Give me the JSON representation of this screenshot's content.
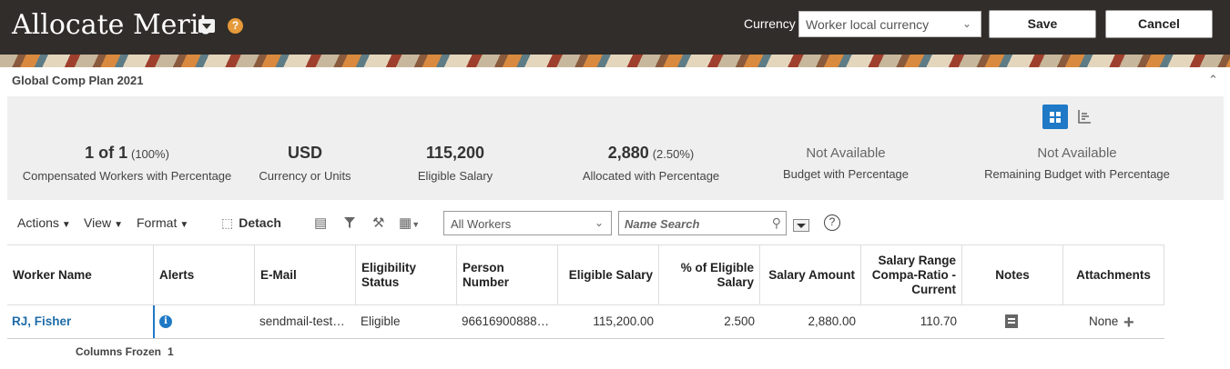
{
  "header": {
    "title": "Allocate Merit",
    "currency_label": "Currency",
    "currency_value": "Worker local currency",
    "save_label": "Save",
    "cancel_label": "Cancel"
  },
  "plan": {
    "title": "Global Comp Plan 2021"
  },
  "summary": {
    "workers": {
      "value": "1 of 1",
      "pct": "(100%)",
      "label": "Compensated Workers with Percentage"
    },
    "currency": {
      "value": "USD",
      "label": "Currency or Units"
    },
    "salary": {
      "value": "115,200",
      "label": "Eligible Salary"
    },
    "allocated": {
      "value": "2,880",
      "pct": "(2.50%)",
      "label": "Allocated with Percentage"
    },
    "budget": {
      "value": "Not Available",
      "label": "Budget with Percentage"
    },
    "remaining": {
      "value": "Not Available",
      "label": "Remaining Budget with Percentage"
    }
  },
  "toolbar": {
    "actions": "Actions",
    "view": "View",
    "format": "Format",
    "detach": "Detach",
    "filter_value": "All Workers",
    "search_placeholder": "Name Search"
  },
  "table": {
    "headers": {
      "worker_name": "Worker Name",
      "alerts": "Alerts",
      "email": "E-Mail",
      "eligibility": "Eligibility Status",
      "person_number": "Person Number",
      "eligible_salary": "Eligible Salary",
      "pct_eligible": "% of Eligible Salary",
      "salary_amount": "Salary Amount",
      "compa_ratio": "Salary Range Compa-Ratio - Current",
      "notes": "Notes",
      "attachments": "Attachments"
    },
    "rows": [
      {
        "worker_name": "RJ, Fisher",
        "email": "sendmail-test…",
        "eligibility": "Eligible",
        "person_number": "96616900888…",
        "eligible_salary": "115,200.00",
        "pct_eligible": "2.500",
        "salary_amount": "2,880.00",
        "compa_ratio": "110.70",
        "attachments": "None"
      }
    ]
  },
  "footer": {
    "columns_frozen_label": "Columns Frozen",
    "columns_frozen_value": "1"
  },
  "colors": {
    "header_bg": "#312d2a",
    "accent": "#1f79c6",
    "summary_bg": "#efefef"
  }
}
